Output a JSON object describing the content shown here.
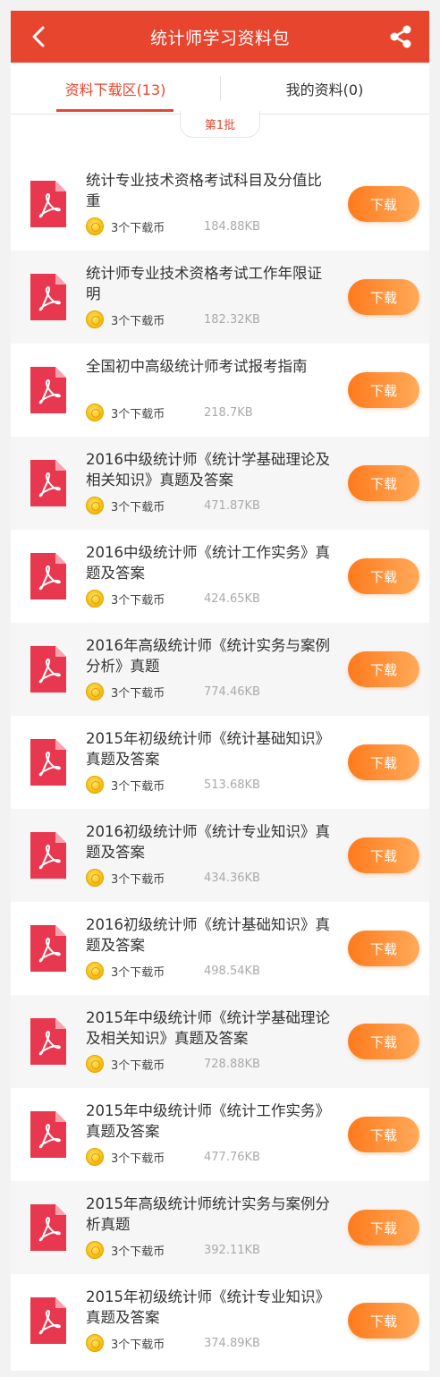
{
  "header": {
    "title": "统计师学习资料包"
  },
  "tabs": [
    {
      "label": "资料下载区(13)"
    },
    {
      "label": "我的资料(0)"
    }
  ],
  "batch_label": "第1批",
  "download_label": "下载",
  "colors": {
    "brand": "#e8452e",
    "button": "#ff8a2a",
    "pdf": "#e8384f"
  },
  "icons": {
    "back": "chevron-left-icon",
    "share": "share-icon",
    "file": "pdf-file-icon",
    "coin": "coin-icon"
  },
  "items": [
    {
      "name": "统计专业技术资格考试科目及分值比重",
      "price": "3个下载币",
      "size": "184.88KB"
    },
    {
      "name": "统计师专业技术资格考试工作年限证明",
      "price": "3个下载币",
      "size": "182.32KB"
    },
    {
      "name": "全国初中高级统计师考试报考指南",
      "price": "3个下载币",
      "size": "218.7KB"
    },
    {
      "name": "2016中级统计师《统计学基础理论及相关知识》真题及答案",
      "price": "3个下载币",
      "size": "471.87KB"
    },
    {
      "name": "2016中级统计师《统计工作实务》真题及答案",
      "price": "3个下载币",
      "size": "424.65KB"
    },
    {
      "name": "2016年高级统计师《统计实务与案例分析》真题",
      "price": "3个下载币",
      "size": "774.46KB"
    },
    {
      "name": "2015年初级统计师《统计基础知识》真题及答案",
      "price": "3个下载币",
      "size": "513.68KB"
    },
    {
      "name": "2016初级统计师《统计专业知识》真题及答案",
      "price": "3个下载币",
      "size": "434.36KB"
    },
    {
      "name": "2016初级统计师《统计基础知识》真题及答案",
      "price": "3个下载币",
      "size": "498.54KB"
    },
    {
      "name": "2015年中级统计师《统计学基础理论及相关知识》真题及答案",
      "price": "3个下载币",
      "size": "728.88KB"
    },
    {
      "name": "2015年中级统计师《统计工作实务》真题及答案",
      "price": "3个下载币",
      "size": "477.76KB"
    },
    {
      "name": "2015年高级统计师统计实务与案例分析真题",
      "price": "3个下载币",
      "size": "392.11KB"
    },
    {
      "name": "2015年初级统计师《统计专业知识》真题及答案",
      "price": "3个下载币",
      "size": "374.89KB"
    }
  ]
}
